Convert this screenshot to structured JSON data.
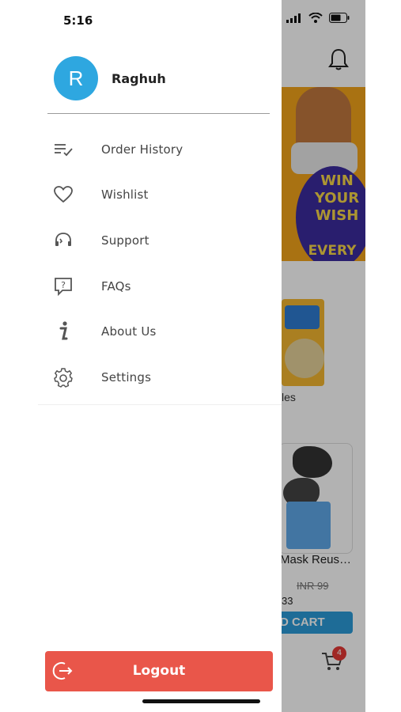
{
  "status_bar": {
    "time": "5:16"
  },
  "profile": {
    "avatar_initial": "R",
    "name": "Raghuh",
    "avatar_color": "#2ea7e0"
  },
  "menu": {
    "items": [
      {
        "label": "Order History",
        "icon": "order-history-icon"
      },
      {
        "label": "Wishlist",
        "icon": "heart-icon"
      },
      {
        "label": "Support",
        "icon": "support-headset-icon"
      },
      {
        "label": "FAQs",
        "icon": "faq-question-icon"
      },
      {
        "label": "About Us",
        "icon": "info-icon"
      },
      {
        "label": "Settings",
        "icon": "gear-icon"
      }
    ]
  },
  "logout": {
    "label": "Logout",
    "color": "#e9564a"
  },
  "background": {
    "banner_lines": [
      "WIN",
      "YOUR",
      "WISH",
      "EVERY DAY"
    ],
    "product1_title_fragment": "les",
    "product2_title": "Mask Reus…",
    "price_old": "INR 99",
    "price_new_fragment": "33",
    "cart_button": "D CART",
    "cart_badge": "4"
  }
}
